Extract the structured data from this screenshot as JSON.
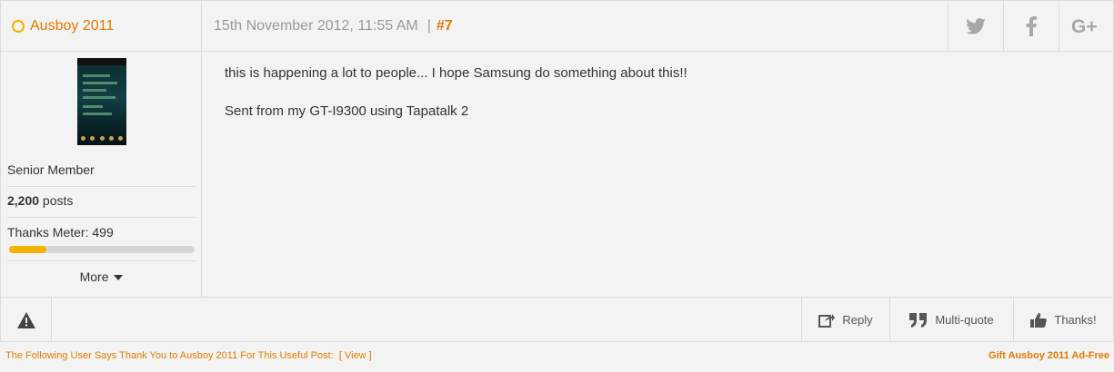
{
  "post": {
    "username": "Ausboy 2011",
    "date": "15th November 2012, 11:55 AM",
    "separator": "|",
    "post_number": "#7",
    "social": [
      "twitter-icon",
      "facebook-icon",
      "google-plus-icon"
    ]
  },
  "sidebar": {
    "title": "Senior Member",
    "posts_count": "2,200",
    "posts_label": " posts",
    "thanks_label": "Thanks Meter: 499",
    "thanks_fraction": 0.2,
    "more_label": "More"
  },
  "content": {
    "line1": "this is happening a lot to people... I hope Samsung do something about this!!",
    "line2": "Sent from my GT-I9300 using Tapatalk 2"
  },
  "footer": {
    "reply_label": "Reply",
    "multiquote_label": "Multi-quote",
    "thanks_label": "Thanks!"
  },
  "bottom": {
    "thanks_text": "The Following User Says Thank You to Ausboy 2011 For This Useful Post:",
    "view_link": "[ View ]",
    "gift_text": "Gift Ausboy 2011 Ad-Free"
  },
  "colors": {
    "accent": "#e07b00",
    "online": "#f4b300"
  }
}
